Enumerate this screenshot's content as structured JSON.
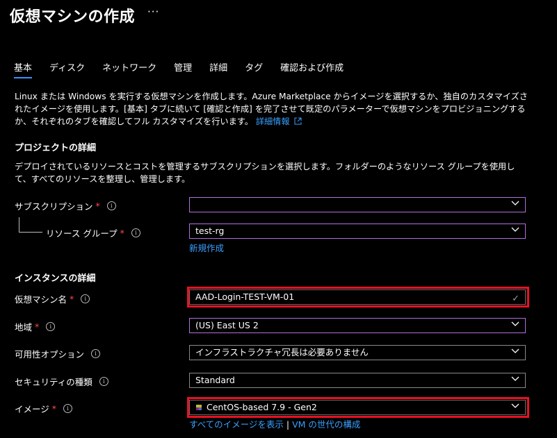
{
  "page": {
    "title": "仮想マシンの作成",
    "more_label": "···"
  },
  "tabs": [
    {
      "label": "基本"
    },
    {
      "label": "ディスク"
    },
    {
      "label": "ネットワーク"
    },
    {
      "label": "管理"
    },
    {
      "label": "詳細"
    },
    {
      "label": "タグ"
    },
    {
      "label": "確認および作成"
    }
  ],
  "intro": {
    "text": "Linux または Windows を実行する仮想マシンを作成します。Azure Marketplace からイメージを選択するか、独自のカスタマイズされたイメージを使用します。[基本] タブに続いて [確認と作成] を完了させて既定のパラメーターで仮想マシンをプロビジョニングするか、それぞれのタブを確認してフル カスタマイズを行います。",
    "link": "詳細情報"
  },
  "project": {
    "title": "プロジェクトの詳細",
    "desc": "デプロイされているリソースとコストを管理するサブスクリプションを選択します。フォルダーのようなリソース グループを使用して、すべてのリソースを整理し、管理します。",
    "subscription_label": "サブスクリプション",
    "subscription_value": "",
    "resource_group_label": "リソース グループ",
    "resource_group_value": "test-rg",
    "create_new_link": "新規作成"
  },
  "instance": {
    "title": "インスタンスの詳細",
    "vm_name_label": "仮想マシン名",
    "vm_name_value": "AAD-Login-TEST-VM-01",
    "region_label": "地域",
    "region_value": "(US) East US 2",
    "availability_label": "可用性オプション",
    "availability_value": "インフラストラクチャ冗長は必要ありません",
    "security_label": "セキュリティの種類",
    "security_value": "Standard",
    "image_label": "イメージ",
    "image_value": "CentOS-based 7.9 - Gen2",
    "all_images_link": "すべてのイメージを表示",
    "separator": "|",
    "vm_gen_link": "VM の世代の構成"
  },
  "colors": {
    "accent": "#3aa0ff",
    "required": "#ff4d4d",
    "highlight": "#e81123",
    "focus_border": "#b46fe0"
  }
}
